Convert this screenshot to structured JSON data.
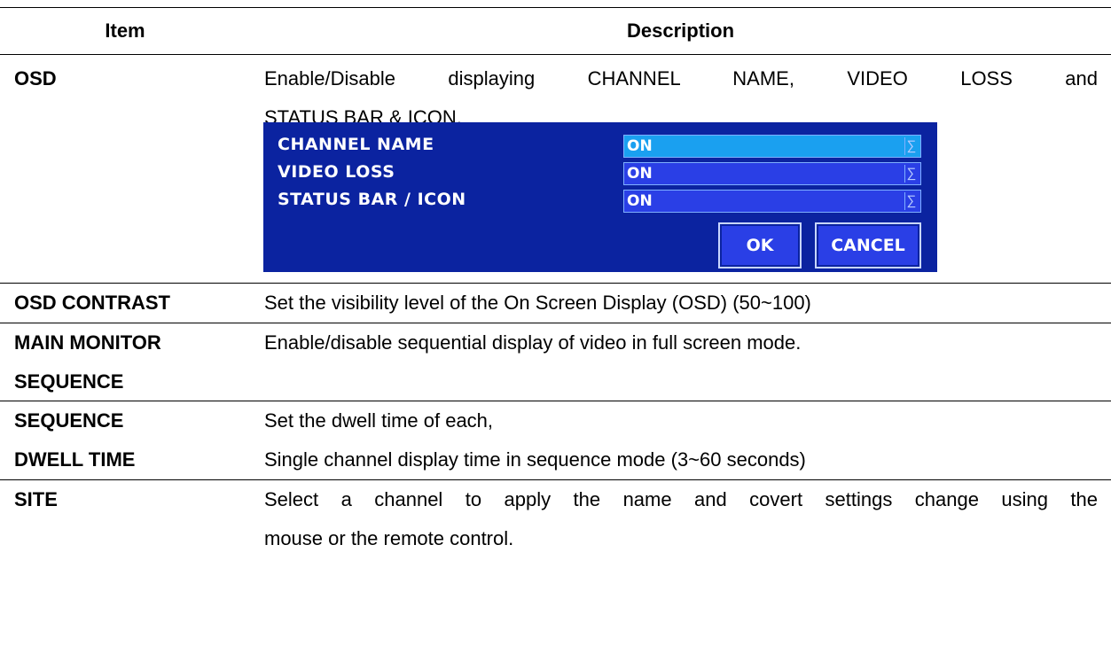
{
  "header": {
    "item": "Item",
    "description": "Description"
  },
  "rows": [
    {
      "item": "OSD",
      "desc_line1": "Enable/Disable displaying CHANNEL NAME, VIDEO LOSS and",
      "desc_line2": "STATUS BAR & ICON."
    },
    {
      "item": "OSD CONTRAST",
      "desc": "Set the visibility level of the On Screen Display (OSD) (50~100)"
    },
    {
      "item_line1": "MAIN MONITOR",
      "item_line2": "SEQUENCE",
      "desc": "Enable/disable sequential display of video in full screen mode."
    },
    {
      "item_line1": "SEQUENCE",
      "item_line2": "DWELL TIME",
      "desc_line1": "Set the dwell time of each,",
      "desc_line2": "Single channel display time in sequence mode (3~60 seconds)"
    },
    {
      "item": "SITE",
      "desc_line1": "Select a channel to apply the name and covert settings change using the",
      "desc_line2": "mouse or the remote control."
    }
  ],
  "osd_dialog": {
    "fields": [
      {
        "label": "CHANNEL NAME",
        "value": "ON",
        "icon": "dropdown-arrow-icon"
      },
      {
        "label": "VIDEO LOSS",
        "value": "ON",
        "icon": "dropdown-arrow-icon"
      },
      {
        "label": "STATUS BAR / ICON",
        "value": "ON",
        "icon": "dropdown-arrow-icon"
      }
    ],
    "ok_label": "OK",
    "cancel_label": "CANCEL",
    "colors": {
      "background": "#0b23a0",
      "active_field": "#1aa0f0",
      "field": "#2a3fe6"
    }
  }
}
